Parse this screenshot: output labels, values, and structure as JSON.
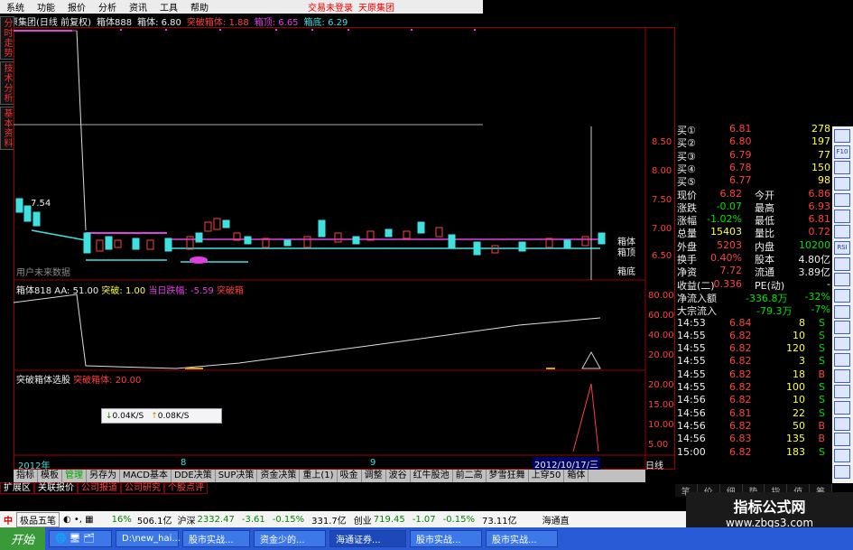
{
  "menu": {
    "items": [
      "系统",
      "功能",
      "报价",
      "分析",
      "资讯",
      "工具",
      "帮助"
    ]
  },
  "notice": {
    "trade": "交易未登录",
    "stock": "天原集团"
  },
  "title": {
    "name": "天原集团(日线 前复权)",
    "box": "箱体888",
    "box_value": "箱体: 6.80",
    "break": "突破箱体: 1.88",
    "top": "箱顶: 6.65",
    "bottom": "箱底: 6.29"
  },
  "left_tabs": [
    "分时走势",
    "技术分析",
    "基本资料"
  ],
  "main_chart": {
    "label_high": "7.54",
    "future_label": "用户未来数据",
    "right_labels": [
      "箱体",
      "箱顶",
      "箱底"
    ],
    "y_ticks": [
      "8.50",
      "8.00",
      "7.50",
      "7.00",
      "6.50"
    ]
  },
  "sub1": {
    "label": "箱体818 AA: 51.00",
    "break": "突破: 1.00",
    "fall": "当日跌幅: -5.59",
    "tag": "突破箱",
    "y_ticks": [
      "80.00",
      "60.00",
      "40.00",
      "20.00"
    ]
  },
  "sub2": {
    "label": "突破箱体选股",
    "value": "突破箱体: 20.00",
    "y_ticks": [
      "20.00",
      "15.00",
      "10.00",
      "5.00"
    ]
  },
  "speed": {
    "down": "0.04K/S",
    "up": "0.08K/S"
  },
  "x_axis": {
    "start": "2012年",
    "m8": "8",
    "m9": "9",
    "date": "2012/10/17/三",
    "period": "日线"
  },
  "quotes": {
    "bids": [
      {
        "label": "买①",
        "price": "6.81",
        "vol": "278"
      },
      {
        "label": "买②",
        "price": "6.80",
        "vol": "197"
      },
      {
        "label": "买③",
        "price": "6.79",
        "vol": "77"
      },
      {
        "label": "买④",
        "price": "6.78",
        "vol": "150"
      },
      {
        "label": "买⑤",
        "price": "6.77",
        "vol": "98"
      }
    ],
    "stats": [
      {
        "k1": "现价",
        "v1": "6.82",
        "k2": "今开",
        "v2": "6.86"
      },
      {
        "k1": "涨跌",
        "v1": "-0.07",
        "k2": "最高",
        "v2": "6.93"
      },
      {
        "k1": "涨幅",
        "v1": "-1.02%",
        "k2": "最低",
        "v2": "6.81"
      },
      {
        "k1": "总量",
        "v1": "15403",
        "k2": "量比",
        "v2": "0.72"
      },
      {
        "k1": "外盘",
        "v1": "5203",
        "k2": "内盘",
        "v2": "10200"
      },
      {
        "k1": "换手",
        "v1": "0.40%",
        "k2": "股本",
        "v2": "4.80亿"
      },
      {
        "k1": "净资",
        "v1": "7.72",
        "k2": "流通",
        "v2": "3.89亿"
      },
      {
        "k1": "收益(二)",
        "v1": "0.336",
        "k2": "PE(动)",
        "v2": "-"
      }
    ],
    "net_inflow": {
      "label": "净流入额",
      "value": "-336.8万",
      "pct": "-32%"
    },
    "big_inflow": {
      "label": "大宗流入",
      "value": "-79.3万",
      "pct": "-7%"
    },
    "ticks": [
      {
        "t": "14:53",
        "p": "6.84",
        "v": "8",
        "d": "S"
      },
      {
        "t": "14:55",
        "p": "6.82",
        "v": "10",
        "d": "S"
      },
      {
        "t": "14:55",
        "p": "6.82",
        "v": "120",
        "d": "S"
      },
      {
        "t": "14:55",
        "p": "6.82",
        "v": "3",
        "d": "S"
      },
      {
        "t": "14:55",
        "p": "6.82",
        "v": "18",
        "d": "B"
      },
      {
        "t": "14:55",
        "p": "6.82",
        "v": "100",
        "d": "S"
      },
      {
        "t": "14:56",
        "p": "6.82",
        "v": "10",
        "d": "S"
      },
      {
        "t": "14:56",
        "p": "6.81",
        "v": "22",
        "d": "S"
      },
      {
        "t": "14:56",
        "p": "6.82",
        "v": "50",
        "d": "B"
      },
      {
        "t": "14:56",
        "p": "6.83",
        "v": "135",
        "d": "B"
      },
      {
        "t": "15:00",
        "p": "6.82",
        "v": "183",
        "d": "S"
      }
    ]
  },
  "right_tabs": [
    "笔",
    "价",
    "细",
    "势",
    "指",
    "值",
    "筹"
  ],
  "icon_labels": [
    "",
    "F10",
    "",
    "",
    "",
    "",
    "",
    "RSI",
    "",
    "",
    "",
    "",
    "",
    "",
    "",
    "",
    "",
    "",
    "",
    "",
    "",
    ""
  ],
  "bottom_tabs": [
    "指标",
    "模板",
    "管理",
    "另存为",
    "MACD基本",
    "DDE决策",
    "SUP决策",
    "资金决策",
    "重上(1)",
    "吸金",
    "调整",
    "波谷",
    "红牛股池",
    "前二高",
    "梦雪狂舞",
    "上穿50",
    "箱体"
  ],
  "sub_tabs": [
    "扩展区",
    "关联报价",
    "公司报道",
    "公司研究",
    "个股点评"
  ],
  "ticker": {
    "logo": "极品五笔",
    "a": "16%",
    "b": "506.1亿",
    "c": "沪深",
    "d": "2332.47",
    "e": "-3.61",
    "f": "-0.15%",
    "g": "331.7亿",
    "h": "创业",
    "i": "719.45",
    "j": "-1.07",
    "k": "-0.15%",
    "l": "73.11亿",
    "m": "海通直"
  },
  "taskbar": {
    "start": "开始",
    "items": [
      "",
      "D:\\new_hai...",
      "股市实战...",
      "资金少的...",
      "海通证券...",
      "股市实战...",
      "股市实战..."
    ]
  },
  "watermark": {
    "line1": "指标公式网",
    "line2": "www.zbgs3.com"
  }
}
